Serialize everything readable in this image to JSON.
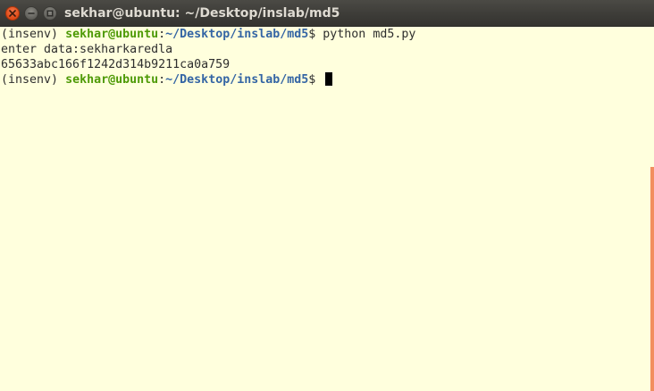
{
  "window": {
    "title": "sekhar@ubuntu: ~/Desktop/inslab/md5"
  },
  "colors": {
    "terminal_bg": "#ffffdd",
    "user_host": "#4e9a06",
    "path": "#3465a4",
    "text": "#2e2e2e",
    "scrollbar": "#f07a4a",
    "close_button": "#df4a16"
  },
  "icons": {
    "close": "close-icon",
    "minimize": "minimize-icon",
    "maximize": "maximize-icon"
  },
  "terminal": {
    "prompt1": {
      "env": "(insenv) ",
      "userhost": "sekhar@ubuntu",
      "colon": ":",
      "path": "~/Desktop/inslab/md5",
      "dollar": "$ ",
      "command": "python md5.py"
    },
    "output": [
      "enter data:sekharkaredla",
      "65633abc166f1242d314b9211ca0a759"
    ],
    "prompt2": {
      "env": "(insenv) ",
      "userhost": "sekhar@ubuntu",
      "colon": ":",
      "path": "~/Desktop/inslab/md5",
      "dollar": "$ ",
      "command": ""
    }
  }
}
